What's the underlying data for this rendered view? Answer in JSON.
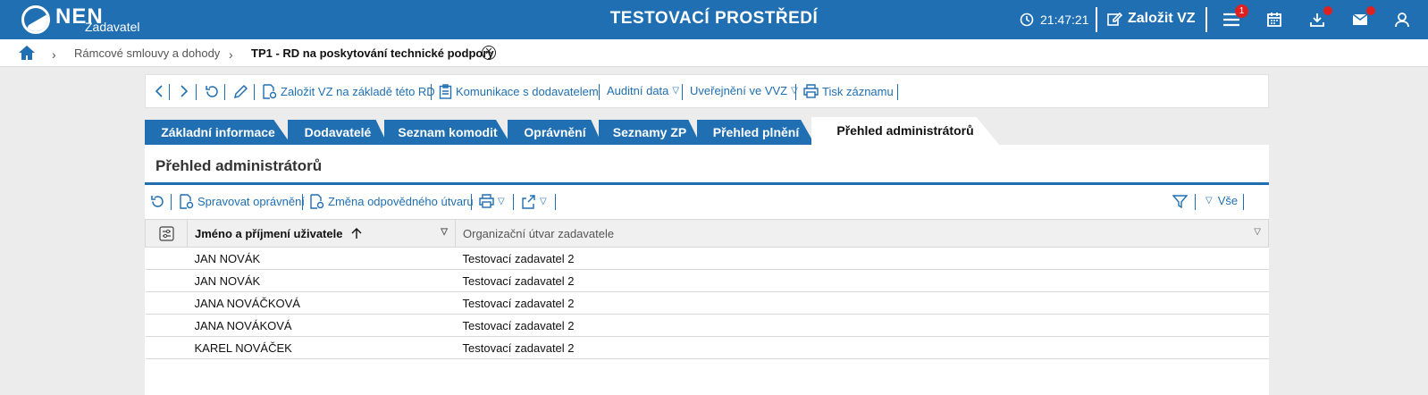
{
  "header": {
    "logo_text": "NEN",
    "logo_sub": "Zadavatel",
    "title": "TESTOVACÍ PROSTŘEDÍ",
    "clock": "21:47:21",
    "create_label": "Založit VZ",
    "menu_badge": "1"
  },
  "breadcrumb": {
    "items": [
      "Rámcové smlouvy a dohody",
      "TP1 - RD na poskytování technické podpory"
    ]
  },
  "actions": {
    "create_vz": "Založit VZ na základě této RD",
    "communication": "Komunikace s dodavatelem",
    "audit": "Auditní data",
    "publish": "Uveřejnění ve VVZ",
    "print": "Tisk záznamu"
  },
  "tabs": [
    "Základní informace",
    "Dodavatelé",
    "Seznam komodit",
    "Oprávnění",
    "Seznamy ZP",
    "Přehled plnění",
    "Přehled administrátorů"
  ],
  "panel": {
    "title": "Přehled administrátorů",
    "manage_perm": "Spravovat oprávnění",
    "change_unit": "Změna odpovědného útvaru",
    "filter_all": "Vše"
  },
  "table": {
    "columns": [
      "Jméno a příjmení uživatele",
      "Organizační útvar zadavatele"
    ],
    "rows": [
      [
        "JAN NOVÁK",
        "Testovací zadavatel 2"
      ],
      [
        "JAN NOVÁK",
        "Testovací zadavatel 2"
      ],
      [
        "JANA NOVÁČKOVÁ",
        "Testovací zadavatel 2"
      ],
      [
        "JANA NOVÁKOVÁ",
        "Testovací zadavatel 2"
      ],
      [
        "KAREL NOVÁČEK",
        "Testovací zadavatel 2"
      ]
    ]
  },
  "colors": {
    "brand": "#1f6fb2",
    "badge": "#e02020"
  }
}
